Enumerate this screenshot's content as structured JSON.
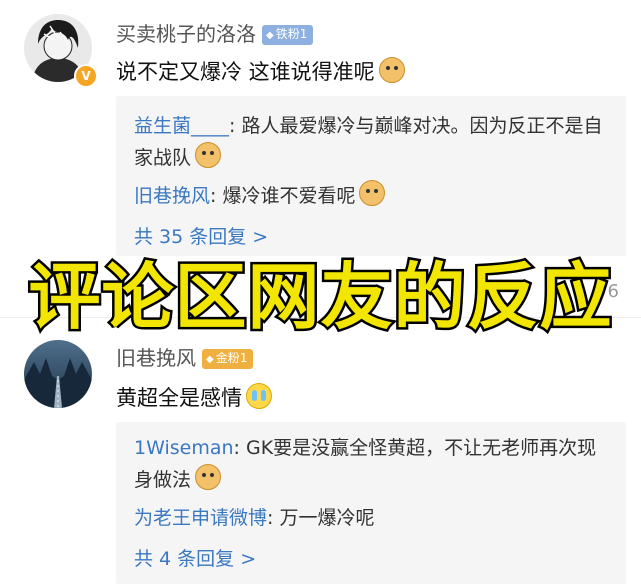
{
  "comments": [
    {
      "username": "买卖桃子的洛洛",
      "badge": "铁粉1",
      "content": "说不定又爆冷 这谁说得准呢",
      "emoji": "doge-emoji",
      "replies": [
        {
          "name": "益生菌____",
          "text": ": 路人最爱爆冷与巅峰对决。因为反正不是自家战队",
          "emoji": "doge-emoji"
        },
        {
          "name": "旧巷挽风",
          "text": ": 爆冷谁不爱看呢",
          "emoji": "doge-emoji"
        }
      ],
      "more_label": "共 35 条回复 >"
    },
    {
      "username": "旧巷挽风",
      "badge": "金粉1",
      "content": "黄超全是感情",
      "emoji": "crying-emoji",
      "replies": [
        {
          "name": "1Wiseman",
          "text": ": GK要是没赢全怪黄超，不让无老师再次现身做法",
          "emoji": "doge-emoji"
        },
        {
          "name": "为老王申请微博",
          "text": ": 万一爆冷呢",
          "emoji": ""
        }
      ],
      "more_label": "共 4 条回复 >"
    }
  ],
  "overlay_title": "评论区网友的反应",
  "partial_timestamp": "6",
  "colors": {
    "link_blue": "#3a78c2",
    "overlay_yellow": "#f2e600",
    "reply_bg": "#f5f5f5"
  }
}
